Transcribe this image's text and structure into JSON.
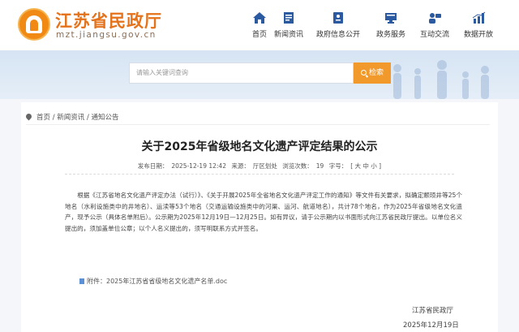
{
  "header": {
    "site_title": "江苏省民政厅",
    "site_url": "mzt.jiangsu.gov.cn"
  },
  "nav": [
    {
      "label": "首页",
      "icon": "home-icon"
    },
    {
      "label": "新闻资讯",
      "icon": "news-icon"
    },
    {
      "label": "政府信息公开",
      "icon": "info-disclosure-icon"
    },
    {
      "label": "政务服务",
      "icon": "service-icon"
    },
    {
      "label": "互动交流",
      "icon": "interaction-icon"
    },
    {
      "label": "数据开放",
      "icon": "data-chart-icon"
    }
  ],
  "search": {
    "placeholder": "请输入关键词查询",
    "button_label": "检索"
  },
  "breadcrumb": "首页 / 新闻资讯 / 通知公告",
  "article": {
    "title": "关于2025年省级地名文化遗产评定结果的公示",
    "meta": {
      "publish_time_label": "发布日期：",
      "publish_time": "2025-12-19 12:42",
      "source_label": "来源：",
      "source": "厅区划处",
      "views_label": "浏览次数：",
      "views": "19",
      "font_label": "字号：",
      "font_sizes": "[ 大 中 小 ]"
    },
    "body": "根据《江苏省地名文化遗产评定办法（试行）》、《关于开展2025年全省地名文化遗产评定工作的通知》等文件有关要求，拟确定颛顼井等25个地名（水利设施类中的井地名）、运渎等53个地名（交通运输设施类中的河渠、运河、航道地名），共计78个地名，作为2025年省级地名文化遗产，现予公示（具体名单附后）。公示期为2025年12月19日—12月25日。如有异议，请于公示期内以书面形式向江苏省民政厅提出。以单位名义提出的，须加盖单位公章；以个人名义提出的，须写明联系方式并签名。",
    "attachment": "附件：2025年江苏省省级地名文化遗产名单.doc",
    "sign_org": "江苏省民政厅",
    "sign_date": "2025年12月19日"
  },
  "colors": {
    "brand_orange": "#e4731b",
    "search_button": "#f19a2b",
    "nav_icon": "#2c5aa0"
  }
}
